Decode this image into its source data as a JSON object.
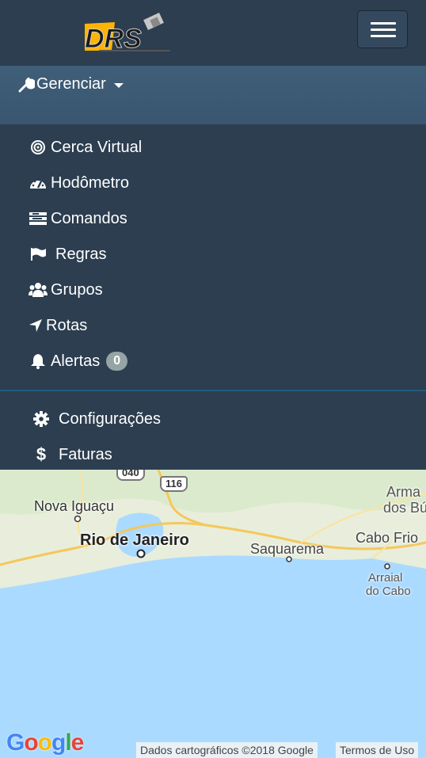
{
  "menu_title": "Gerenciar",
  "menu_items": [
    {
      "label": "Cerca Virtual",
      "icon": "target-icon"
    },
    {
      "label": "Hodômetro",
      "icon": "tachometer-icon"
    },
    {
      "label": "Comandos",
      "icon": "list-icon"
    },
    {
      "label": "Regras",
      "icon": "flag-icon"
    },
    {
      "label": "Grupos",
      "icon": "users-icon"
    },
    {
      "label": "Rotas",
      "icon": "location-arrow-icon"
    },
    {
      "label": "Alertas",
      "icon": "bell-icon",
      "badge": "0"
    }
  ],
  "settings_items": [
    {
      "label": "Configurações",
      "icon": "gear-icon"
    },
    {
      "label": "Faturas",
      "icon": "dollar-icon"
    }
  ],
  "map": {
    "labels": {
      "nova_iguacu": "Nova Iguaçu",
      "rio": "Rio de Janeiro",
      "saquarema": "Saquarema",
      "cabo_frio": "Cabo Frio",
      "armacao_1": "Arma",
      "armacao_2": "dos Bú",
      "arraial_1": "Arraial",
      "arraial_2": "do Cabo"
    },
    "roads": {
      "r1": "040",
      "r2": "116"
    },
    "attribution": "Dados cartográficos ©2018 Google",
    "terms": "Termos de Uso",
    "google_logo": "Google"
  },
  "colors": {
    "navbar": "#2c3e50",
    "active": "#3e5c76",
    "badge": "#95a5a6",
    "water": "#aadaff",
    "land": "#e8eedb"
  }
}
